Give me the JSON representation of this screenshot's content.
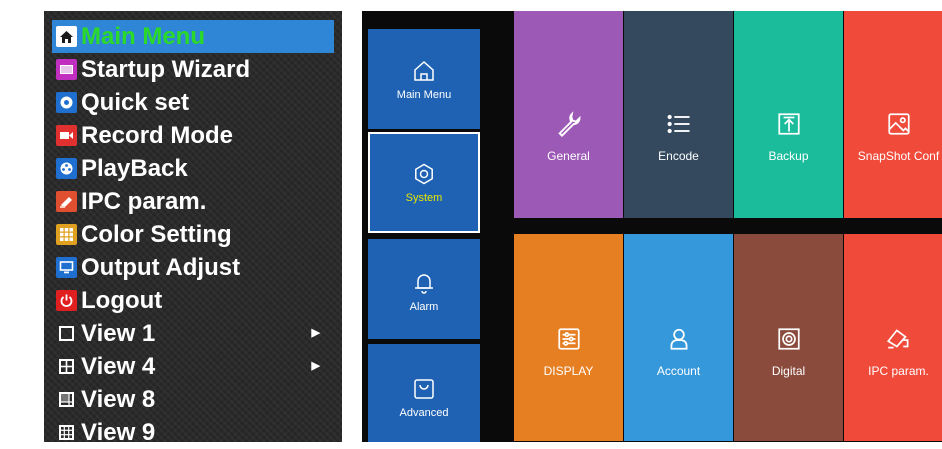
{
  "context_menu": {
    "items": [
      {
        "label": "Main Menu",
        "icon": "home-icon",
        "color": "#ffffff",
        "selected": true
      },
      {
        "label": "Startup Wizard",
        "icon": "wizard-icon",
        "color": "#c02fc0"
      },
      {
        "label": "Quick set",
        "icon": "quick-set-icon",
        "color": "#1e6fd0"
      },
      {
        "label": "Record Mode",
        "icon": "record-icon",
        "color": "#e03030"
      },
      {
        "label": "PlayBack",
        "icon": "playback-icon",
        "color": "#1e6fd0"
      },
      {
        "label": "IPC param.",
        "icon": "ipc-camera-icon",
        "color": "#e05030"
      },
      {
        "label": "Color Setting",
        "icon": "color-grid-icon",
        "color": "#e0a020"
      },
      {
        "label": "Output Adjust",
        "icon": "monitor-icon",
        "color": "#1e6fd0"
      },
      {
        "label": "Logout",
        "icon": "power-icon",
        "color": "#e02020"
      },
      {
        "label": "View 1",
        "icon": "view-1-icon",
        "has_submenu": true
      },
      {
        "label": "View 4",
        "icon": "view-4-icon",
        "has_submenu": true
      },
      {
        "label": "View 8",
        "icon": "view-8-icon"
      },
      {
        "label": "View 9",
        "icon": "view-9-icon"
      }
    ],
    "colors": {
      "selected_bg": "#2f86d6",
      "selected_text": "#2bd92b",
      "text": "#ffffff"
    }
  },
  "nav": {
    "items": [
      {
        "label": "Main Menu",
        "icon": "home-icon"
      },
      {
        "label": "System",
        "icon": "gear-icon",
        "active": true
      },
      {
        "label": "Alarm",
        "icon": "bell-icon"
      },
      {
        "label": "Advanced",
        "icon": "bag-icon"
      }
    ],
    "colors": {
      "bg": "#1f62b3",
      "active_text": "#e6e600"
    }
  },
  "tiles": [
    {
      "label": "General",
      "icon": "wrench-icon",
      "color": "#9c59b6"
    },
    {
      "label": "Encode",
      "icon": "list-icon",
      "color": "#34495e"
    },
    {
      "label": "Backup",
      "icon": "upload-icon",
      "color": "#1abc9c"
    },
    {
      "label": "SnapShot Conf",
      "icon": "image-icon",
      "color": "#f04a3a"
    },
    {
      "label": "DISPLAY",
      "icon": "sliders-icon",
      "color": "#e67e22"
    },
    {
      "label": "Account",
      "icon": "user-icon",
      "color": "#3498db"
    },
    {
      "label": "Digital",
      "icon": "digital-icon",
      "color": "#8a4a3c"
    },
    {
      "label": "IPC param.",
      "icon": "ipc-camera-icon",
      "color": "#f04a3a"
    }
  ]
}
